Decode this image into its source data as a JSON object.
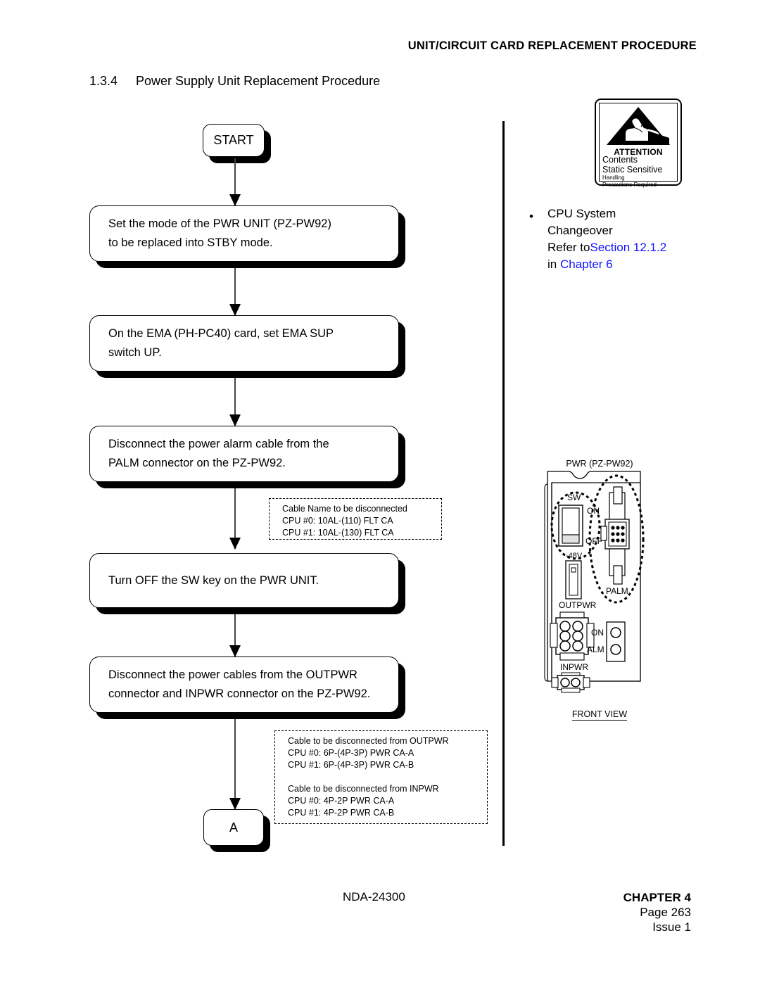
{
  "header": {
    "title": "UNIT/CIRCUIT CARD REPLACEMENT PROCEDURE"
  },
  "section": {
    "number": "1.3.4",
    "title": "Power Supply Unit Replacement Procedure"
  },
  "flowchart": {
    "start_label": "START",
    "connector_label": "A",
    "steps": [
      "Set the mode of the PWR UNIT (PZ-PW92)\nto be replaced into STBY mode.",
      "On the EMA (PH-PC40) card, set EMA SUP\nswitch UP.",
      "Disconnect the power alarm cable from the\nPALM connector on the PZ-PW92.",
      "Turn OFF the SW key on the PWR UNIT.",
      "Disconnect the power cables from the OUTPWR\nconnector and INPWR connector on the PZ-PW92."
    ],
    "note1": "Cable Name to be disconnected\nCPU #0: 10AL-(110) FLT CA\nCPU #1: 10AL-(130) FLT CA",
    "note2": "Cable to be disconnected from OUTPWR\nCPU #0: 6P-(4P-3P) PWR CA-A\nCPU #1: 6P-(4P-3P) PWR CA-B\n\nCable to be disconnected from INPWR\nCPU #0: 4P-2P PWR CA-A\nCPU #1: 4P-2P PWR CA-B"
  },
  "sidebar": {
    "bullet": "•",
    "line1": "CPU System",
    "line2": "Changeover",
    "refer_text": "Refer to",
    "link_section": "Section 12.1.2",
    "in_text": "in ",
    "link_chapter": "Chapter 6",
    "link_color": "#1414ff"
  },
  "esd_label": {
    "icon": "esd-hand-warning-icon",
    "attention": "ATTENTION",
    "line1": "Contents",
    "line2": "Static Sensitive",
    "line3": "Handling",
    "line4": "Precautions Required"
  },
  "pwr_unit": {
    "caption": "PWR (PZ-PW92)",
    "front_view": "FRONT VIEW",
    "sw_label": "SW",
    "on_label": "ON",
    "off_label": "OFF",
    "volt_label": "-48V",
    "palm_label": "PALM",
    "outpwr_label": "OUTPWR",
    "inpwr_label": "INPWR",
    "led_on_label": "ON",
    "led_alm_label": "ALM"
  },
  "footer": {
    "doc_number": "NDA-24300",
    "chapter": "CHAPTER 4",
    "page": "Page 263",
    "issue": "Issue 1"
  }
}
